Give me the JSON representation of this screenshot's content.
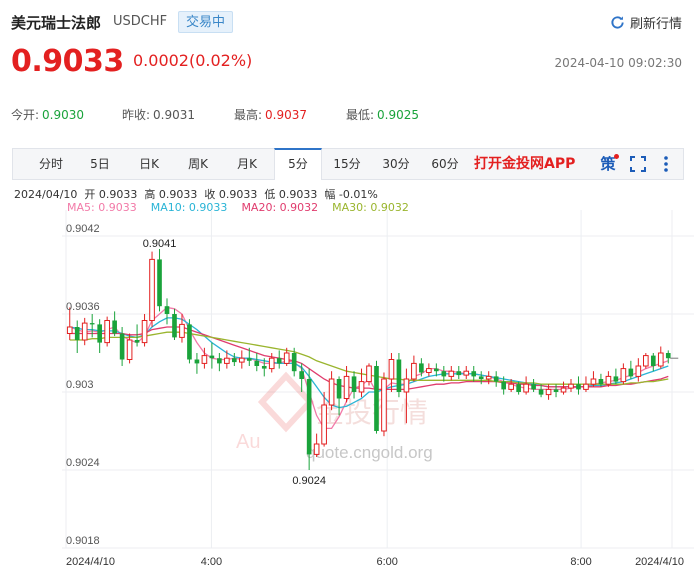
{
  "header": {
    "name": "美元瑞士法郎",
    "code": "USDCHF",
    "status": "交易中",
    "refresh_label": "刷新行情"
  },
  "quote": {
    "price": "0.9033",
    "change": "0.0002(0.02%)",
    "datetime": "2024-04-10 09:02:30"
  },
  "stats": [
    {
      "label": "今开:",
      "value": "0.9030",
      "color": "green"
    },
    {
      "label": "昨收:",
      "value": "0.9031",
      "color": "plain"
    },
    {
      "label": "最高:",
      "value": "0.9037",
      "color": "red"
    },
    {
      "label": "最低:",
      "value": "0.9025",
      "color": "green"
    }
  ],
  "tabs": [
    "分时",
    "5日",
    "日K",
    "周K",
    "月K",
    "5分",
    "15分",
    "30分",
    "60分"
  ],
  "active_tab": "5分",
  "app_link": "打开金投网APP",
  "toolbar_icons": {
    "draw": "策",
    "fullscreen": "fullscreen-icon",
    "more": "more-icon"
  },
  "ohlc": {
    "date": "2024/04/10",
    "open": "开 0.9033",
    "high": "高 0.9033",
    "close": "收 0.9033",
    "low": "低 0.9033",
    "amplitude": "幅 -0.01%"
  },
  "ma": [
    {
      "label": "MA5: 0.9033",
      "color": "#f27aa8"
    },
    {
      "label": "MA10: 0.9033",
      "color": "#2ab4d6"
    },
    {
      "label": "MA20: 0.9032",
      "color": "#e03c6e"
    },
    {
      "label": "MA30: 0.9032",
      "color": "#9ab52e"
    }
  ],
  "watermark": {
    "brand": "金投行情",
    "url": "quote.cngold.org"
  },
  "colors": {
    "up": "#e32020",
    "down": "#1aa33b",
    "accent": "#2f74c8"
  },
  "chart_data": {
    "type": "candlestick",
    "ylim": [
      0.9018,
      0.9044
    ],
    "y_ticks": [
      "0.9042",
      "0.9036",
      "0.903",
      "0.9024",
      "0.9018"
    ],
    "x_ticks": [
      "2024/4/10",
      "4:00",
      "6:00",
      "8:00",
      "2024/4/10"
    ],
    "annotations": {
      "high": "0.9041",
      "low": "0.9024"
    },
    "candles": [
      [
        0.90345,
        0.9035,
        0.90365,
        0.9034
      ],
      [
        0.9035,
        0.9034,
        0.90355,
        0.9033
      ],
      [
        0.9034,
        0.90353,
        0.90357,
        0.90336
      ],
      [
        0.90353,
        0.90352,
        0.9036,
        0.90342
      ],
      [
        0.90352,
        0.90338,
        0.90356,
        0.9033
      ],
      [
        0.90338,
        0.90355,
        0.90358,
        0.90335
      ],
      [
        0.90355,
        0.90345,
        0.90362,
        0.90343
      ],
      [
        0.90345,
        0.90325,
        0.9035,
        0.9032
      ],
      [
        0.90325,
        0.9034,
        0.90345,
        0.90322
      ],
      [
        0.9034,
        0.90338,
        0.90352,
        0.90335
      ],
      [
        0.90338,
        0.90355,
        0.9036,
        0.90335
      ],
      [
        0.90355,
        0.90402,
        0.90408,
        0.9035
      ],
      [
        0.90402,
        0.90366,
        0.9041,
        0.90362
      ],
      [
        0.90366,
        0.9036,
        0.90372,
        0.90352
      ],
      [
        0.9036,
        0.90342,
        0.90364,
        0.9034
      ],
      [
        0.90342,
        0.90352,
        0.9036,
        0.90338
      ],
      [
        0.90352,
        0.90325,
        0.90356,
        0.90322
      ],
      [
        0.90325,
        0.90322,
        0.9033,
        0.90314
      ],
      [
        0.90322,
        0.90328,
        0.90334,
        0.90318
      ],
      [
        0.90328,
        0.90326,
        0.90338,
        0.90318
      ],
      [
        0.90326,
        0.90322,
        0.9033,
        0.90316
      ],
      [
        0.90322,
        0.90326,
        0.90332,
        0.90318
      ],
      [
        0.90326,
        0.90323,
        0.9033,
        0.9032
      ],
      [
        0.90323,
        0.90326,
        0.90332,
        0.90318
      ],
      [
        0.90326,
        0.90324,
        0.90334,
        0.9032
      ],
      [
        0.90324,
        0.9032,
        0.9033,
        0.90316
      ],
      [
        0.9032,
        0.90318,
        0.90326,
        0.90312
      ],
      [
        0.90318,
        0.90326,
        0.9033,
        0.90315
      ],
      [
        0.90326,
        0.90322,
        0.90332,
        0.90318
      ],
      [
        0.90322,
        0.9033,
        0.90334,
        0.9032
      ],
      [
        0.9033,
        0.90316,
        0.90334,
        0.90312
      ],
      [
        0.90316,
        0.9031,
        0.90322,
        0.903
      ],
      [
        0.9031,
        0.90252,
        0.90318,
        0.9024
      ],
      [
        0.90252,
        0.9026,
        0.90268,
        0.9025
      ],
      [
        0.9026,
        0.9029,
        0.903,
        0.90258
      ],
      [
        0.9029,
        0.9031,
        0.90316,
        0.90286
      ],
      [
        0.9031,
        0.90295,
        0.90312,
        0.90282
      ],
      [
        0.90295,
        0.90312,
        0.9032,
        0.90292
      ],
      [
        0.90312,
        0.903,
        0.90316,
        0.90295
      ],
      [
        0.903,
        0.90308,
        0.90318,
        0.90296
      ],
      [
        0.90308,
        0.9032,
        0.90322,
        0.90305
      ],
      [
        0.9032,
        0.9027,
        0.90324,
        0.90268
      ],
      [
        0.9027,
        0.9031,
        0.90315,
        0.90266
      ],
      [
        0.9031,
        0.90325,
        0.9033,
        0.903
      ],
      [
        0.90325,
        0.903,
        0.9033,
        0.90296
      ],
      [
        0.903,
        0.9031,
        0.90318,
        0.90276
      ],
      [
        0.9031,
        0.90322,
        0.90328,
        0.90308
      ],
      [
        0.90322,
        0.90315,
        0.90326,
        0.90312
      ],
      [
        0.90315,
        0.90318,
        0.90322,
        0.90312
      ],
      [
        0.90318,
        0.90316,
        0.90322,
        0.90312
      ],
      [
        0.90316,
        0.90312,
        0.9032,
        0.90308
      ],
      [
        0.90312,
        0.90316,
        0.9032,
        0.90309
      ],
      [
        0.90316,
        0.90313,
        0.9032,
        0.9031
      ],
      [
        0.90313,
        0.90316,
        0.9032,
        0.9031
      ],
      [
        0.90316,
        0.90312,
        0.9032,
        0.90308
      ],
      [
        0.90312,
        0.9031,
        0.90316,
        0.90306
      ],
      [
        0.9031,
        0.90312,
        0.90316,
        0.90306
      ],
      [
        0.90312,
        0.90308,
        0.90316,
        0.90304
      ],
      [
        0.90308,
        0.90302,
        0.90312,
        0.90298
      ],
      [
        0.90302,
        0.90306,
        0.9031,
        0.903
      ],
      [
        0.90306,
        0.903,
        0.90308,
        0.90298
      ],
      [
        0.903,
        0.90306,
        0.90312,
        0.90298
      ],
      [
        0.90306,
        0.90302,
        0.9031,
        0.903
      ],
      [
        0.90302,
        0.90298,
        0.90306,
        0.90296
      ],
      [
        0.90298,
        0.90302,
        0.90306,
        0.90294
      ],
      [
        0.90302,
        0.903,
        0.90306,
        0.90296
      ],
      [
        0.903,
        0.90303,
        0.90308,
        0.90298
      ],
      [
        0.90303,
        0.90306,
        0.9031,
        0.903
      ],
      [
        0.90306,
        0.90302,
        0.90312,
        0.90298
      ],
      [
        0.90302,
        0.90306,
        0.90312,
        0.903
      ],
      [
        0.90306,
        0.9031,
        0.90316,
        0.90304
      ],
      [
        0.9031,
        0.90306,
        0.90314,
        0.90304
      ],
      [
        0.90306,
        0.90312,
        0.90316,
        0.90304
      ],
      [
        0.90312,
        0.90308,
        0.90318,
        0.90306
      ],
      [
        0.90308,
        0.90318,
        0.90322,
        0.90306
      ],
      [
        0.90318,
        0.90312,
        0.90324,
        0.9031
      ],
      [
        0.90312,
        0.9032,
        0.90326,
        0.90308
      ],
      [
        0.9032,
        0.90328,
        0.9033,
        0.90318
      ],
      [
        0.90328,
        0.9032,
        0.9033,
        0.90316
      ],
      [
        0.9032,
        0.9033,
        0.90335,
        0.90318
      ],
      [
        0.9033,
        0.90326,
        0.90332,
        0.90322
      ]
    ],
    "ma5": [
      0.9035,
      0.90348,
      0.90346,
      0.90347,
      0.90346,
      0.90348,
      0.9035,
      0.90343,
      0.9034,
      0.90338,
      0.90343,
      0.90355,
      0.9036,
      0.90365,
      0.90364,
      0.9036,
      0.90348,
      0.90338,
      0.9033,
      0.90326,
      0.90325,
      0.90325,
      0.90326,
      0.90325,
      0.90326,
      0.90324,
      0.90322,
      0.90322,
      0.90322,
      0.90324,
      0.90323,
      0.90318,
      0.903,
      0.90282,
      0.90272,
      0.90272,
      0.90281,
      0.90293,
      0.90303,
      0.90305,
      0.9031,
      0.903,
      0.90302,
      0.90307,
      0.90306,
      0.90306,
      0.90312,
      0.90314,
      0.90318,
      0.90318,
      0.90316,
      0.90316,
      0.90315,
      0.90314,
      0.90314,
      0.90313,
      0.90312,
      0.9031,
      0.90308,
      0.90306,
      0.90304,
      0.90303,
      0.90302,
      0.90302,
      0.90302,
      0.90302,
      0.90302,
      0.90303,
      0.90304,
      0.90304,
      0.90306,
      0.90307,
      0.90308,
      0.90309,
      0.90311,
      0.90313,
      0.90315,
      0.90318,
      0.9032,
      0.90322,
      0.90324
    ],
    "ma10": [
      0.9035,
      0.90349,
      0.90348,
      0.90348,
      0.90347,
      0.90347,
      0.90347,
      0.90345,
      0.90343,
      0.90342,
      0.90344,
      0.9035,
      0.90354,
      0.90357,
      0.90357,
      0.90356,
      0.90352,
      0.90348,
      0.90343,
      0.90338,
      0.90334,
      0.9033,
      0.90327,
      0.90326,
      0.90326,
      0.90325,
      0.90324,
      0.90323,
      0.90322,
      0.90322,
      0.90322,
      0.90319,
      0.90312,
      0.90304,
      0.90296,
      0.9029,
      0.90288,
      0.90289,
      0.90292,
      0.90295,
      0.903,
      0.903,
      0.90302,
      0.90304,
      0.90305,
      0.90306,
      0.90308,
      0.9031,
      0.90312,
      0.90313,
      0.90314,
      0.90314,
      0.90314,
      0.90314,
      0.90314,
      0.90313,
      0.90312,
      0.90311,
      0.9031,
      0.90309,
      0.90308,
      0.90307,
      0.90306,
      0.90305,
      0.90304,
      0.90304,
      0.90304,
      0.90304,
      0.90304,
      0.90304,
      0.90305,
      0.90305,
      0.90306,
      0.90307,
      0.90308,
      0.9031,
      0.90312,
      0.90314,
      0.90316,
      0.90318,
      0.9032
    ],
    "ma20": [
      0.90345,
      0.90345,
      0.90345,
      0.90345,
      0.90345,
      0.90345,
      0.90345,
      0.90345,
      0.90344,
      0.90344,
      0.90345,
      0.90348,
      0.90349,
      0.9035,
      0.9035,
      0.9035,
      0.90348,
      0.90346,
      0.90344,
      0.90342,
      0.9034,
      0.90338,
      0.90336,
      0.90334,
      0.90332,
      0.9033,
      0.90328,
      0.90327,
      0.90326,
      0.90325,
      0.90324,
      0.90322,
      0.90318,
      0.90314,
      0.9031,
      0.90307,
      0.90305,
      0.90304,
      0.90303,
      0.90303,
      0.90303,
      0.90302,
      0.90302,
      0.90302,
      0.90302,
      0.90302,
      0.90303,
      0.90304,
      0.90305,
      0.90306,
      0.90306,
      0.90307,
      0.90307,
      0.90308,
      0.90308,
      0.90308,
      0.90308,
      0.90308,
      0.90307,
      0.90307,
      0.90306,
      0.90306,
      0.90305,
      0.90305,
      0.90304,
      0.90304,
      0.90304,
      0.90304,
      0.90304,
      0.90304,
      0.90304,
      0.90304,
      0.90305,
      0.90305,
      0.90306,
      0.90306,
      0.90307,
      0.90308,
      0.90309,
      0.9031,
      0.90312
    ],
    "ma30": [
      0.9034,
      0.9034,
      0.9034,
      0.90341,
      0.90341,
      0.90342,
      0.90342,
      0.90342,
      0.90342,
      0.90342,
      0.90343,
      0.90344,
      0.90345,
      0.90346,
      0.90346,
      0.90346,
      0.90345,
      0.90344,
      0.90343,
      0.90342,
      0.90341,
      0.9034,
      0.90339,
      0.90338,
      0.90337,
      0.90336,
      0.90335,
      0.90334,
      0.90333,
      0.90332,
      0.90331,
      0.90329,
      0.90327,
      0.90324,
      0.90322,
      0.9032,
      0.90318,
      0.90316,
      0.90315,
      0.90314,
      0.90313,
      0.90312,
      0.90311,
      0.9031,
      0.9031,
      0.90309,
      0.90309,
      0.90309,
      0.90309,
      0.90309,
      0.90309,
      0.90309,
      0.90309,
      0.90309,
      0.90309,
      0.90309,
      0.90309,
      0.90308,
      0.90308,
      0.90308,
      0.90307,
      0.90307,
      0.90307,
      0.90306,
      0.90306,
      0.90306,
      0.90306,
      0.90306,
      0.90306,
      0.90306,
      0.90306,
      0.90306,
      0.90306,
      0.90306,
      0.90306,
      0.90307,
      0.90307,
      0.90308,
      0.90308,
      0.90309,
      0.9031
    ]
  }
}
